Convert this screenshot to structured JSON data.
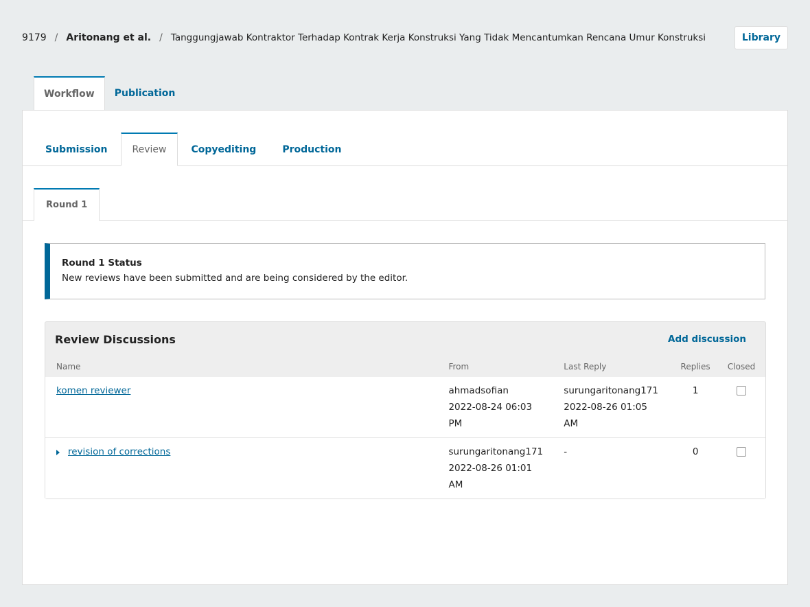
{
  "header": {
    "submission_id": "9179",
    "authors": "Aritonang et al.",
    "title": "Tanggungjawab Kontraktor Terhadap Kontrak Kerja Konstruksi Yang Tidak Mencantumkan Rencana Umur Konstruksi",
    "separator": "/",
    "library_label": "Library"
  },
  "top_tabs": [
    "Workflow",
    "Publication"
  ],
  "stage_tabs": [
    "Submission",
    "Review",
    "Copyediting",
    "Production"
  ],
  "round_tab": "Round 1",
  "status": {
    "title": "Round 1 Status",
    "text": "New reviews have been submitted and are being considered by the editor."
  },
  "discussions": {
    "title": "Review Discussions",
    "add_label": "Add discussion",
    "columns": {
      "name": "Name",
      "from": "From",
      "last_reply": "Last Reply",
      "replies": "Replies",
      "closed": "Closed"
    },
    "rows": [
      {
        "name": "komen reviewer",
        "from_user": "ahmadsofian",
        "from_date": "2022-08-24 06:03",
        "from_time": "PM",
        "last_user": "surungaritonang171",
        "last_date": "2022-08-26 01:05",
        "last_time": "AM",
        "replies": "1"
      },
      {
        "name": "revision of corrections",
        "from_user": "surungaritonang171",
        "from_date": "2022-08-26 01:01",
        "from_time": "AM",
        "last_user": "-",
        "replies": "0"
      }
    ]
  }
}
